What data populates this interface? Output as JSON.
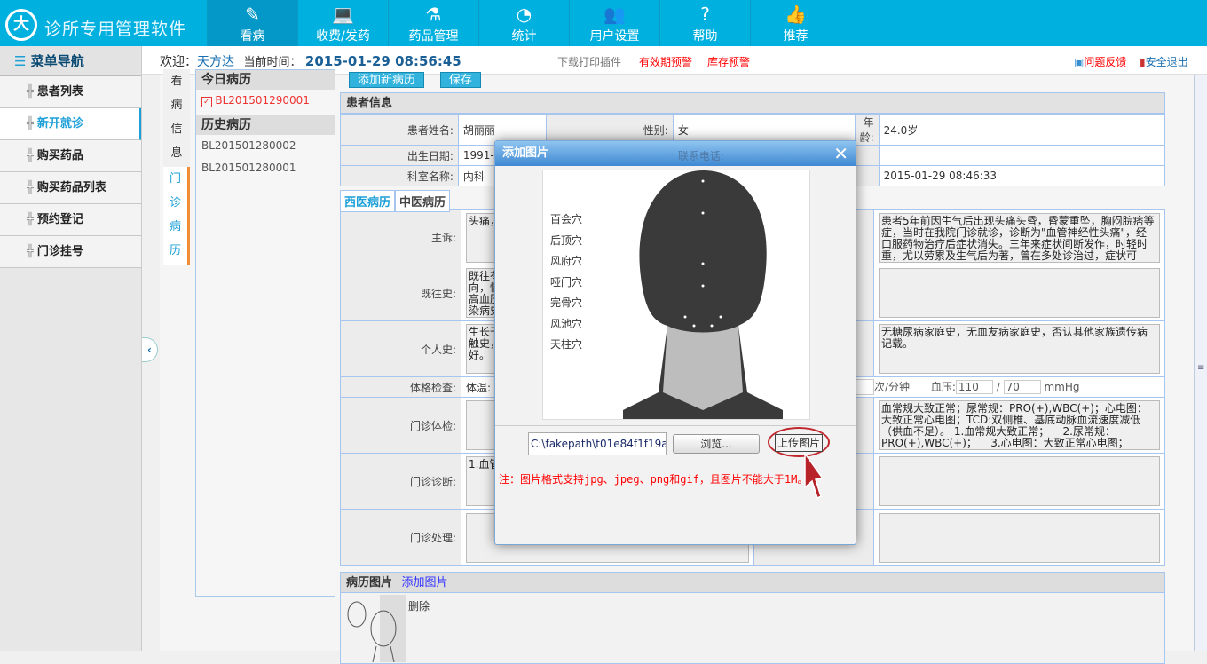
{
  "header": {
    "logo": "大",
    "title": "诊所专用管理软件",
    "nav": [
      {
        "label": "看病",
        "icon": "✎"
      },
      {
        "label": "收费/发药",
        "icon": "💻"
      },
      {
        "label": "药品管理",
        "icon": "⚗"
      },
      {
        "label": "统计",
        "icon": "◔"
      },
      {
        "label": "用户设置",
        "icon": "👥"
      },
      {
        "label": "帮助",
        "icon": "?"
      },
      {
        "label": "推荐",
        "icon": "👍"
      }
    ]
  },
  "subbar": {
    "welcome": "欢迎：",
    "user": "天方达",
    "time_label": "当前时间：",
    "time": "2015-01-29  08:56:45",
    "links": [
      "下载打印插件",
      "有效期预警",
      "库存预警"
    ],
    "feedback": "问题反馈",
    "logout": "安全退出"
  },
  "sidebar": {
    "title": "菜单导航",
    "items": [
      "患者列表",
      "新开就诊",
      "购买药品",
      "购买药品列表",
      "预约登记",
      "门诊挂号"
    ]
  },
  "vtabs": [
    "看病信息",
    "门诊病历"
  ],
  "records": {
    "today_title": "今日病历",
    "today": [
      "BL201501290001"
    ],
    "history_title": "历史病历",
    "history": [
      "BL201501280002",
      "BL201501280001"
    ]
  },
  "toolbar": {
    "add": "添加新病历",
    "save": "保存"
  },
  "patient": {
    "title": "患者信息",
    "name_label": "患者姓名:",
    "name": "胡丽丽",
    "gender_label": "性别:",
    "gender": "女",
    "age_label": "年龄:",
    "age": "24.0岁",
    "birth_label": "出生日期:",
    "birth": "1991-01-13",
    "phone_label": "联系电话:",
    "dept_label": "科室名称:",
    "dept": "内科",
    "visit_time": "2015-01-29 08:46:33"
  },
  "tabs": [
    "西医病历",
    "中医病历"
  ],
  "form": {
    "chief_label": "主诉:",
    "chief": "头痛，",
    "chief_right": "患者5年前因生气后出现头痛头昏，昏蒙重坠，胸闷脘痞等症，当时在我院门诊就诊，诊断为\"血管神经性头痛\"，经口服药物治疗后症状消失。三年来症状间断发作，时轻时重，尤以劳累及生气后为著，曾在多处诊治过，症状可",
    "past_label": "既往史:",
    "past": "既往有\n向，情\n高血压\n染病史",
    "personal_label": "个人史:",
    "personal": "生长于\n触史，\n好。",
    "family": "无糖尿病家庭史，无血友病家庭史，否认其他家族遗传病记载。",
    "exam_label": "体格检查:",
    "temp_label": "体温:",
    "pulse_unit": "次/分钟",
    "bp_label": "血压:",
    "bp_high": "110",
    "bp_sep": "/",
    "bp_low": "70",
    "bp_unit": "mmHg",
    "clinic_exam_label": "门诊体检:",
    "clinic_exam_right": "血常规大致正常；尿常规：PRO(+),WBC(+)；心电图：大致正常心电图；TCD:双侧椎、基底动脉血流速度减低（供血不足）。 1.血常规大致正常；    2.尿常规：PRO(+),WBC(+)；    3.心电图：大致正常心电图；",
    "diag_label": "门诊诊断:",
    "diag": "1.血管",
    "treat_label": "门诊处理:"
  },
  "images": {
    "title": "病历图片",
    "add": "添加图片",
    "delete": "删除"
  },
  "dialog": {
    "title": "添加图片",
    "points": [
      "百会穴",
      "后顶穴",
      "风府穴",
      "哑门穴",
      "完骨穴",
      "风池穴",
      "天柱穴"
    ],
    "file": "C:\\fakepath\\t01e84f1f19a9",
    "browse": "浏览...",
    "upload": "上传图片",
    "note": "注：图片格式支持jpg、jpeg、png和gif，且图片不能大于1M。"
  },
  "colors": {
    "header": "#00b0df",
    "accent": "#1da0d8",
    "warning": "#ff0000"
  }
}
